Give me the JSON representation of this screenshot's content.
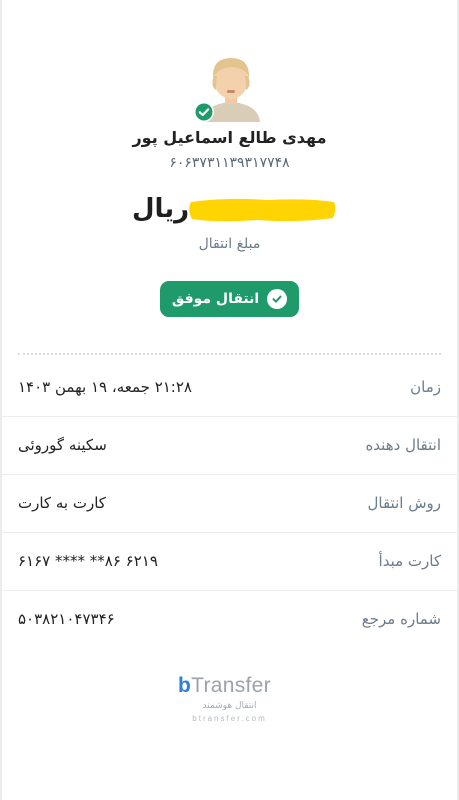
{
  "recipient": {
    "name": "مهدی طالع اسماعیل پور",
    "card_number": "۶۰۶۳۷۳۱۱۳۹۳۱۷۷۴۸"
  },
  "amount": {
    "currency": "ریال",
    "label": "مبلغ انتقال"
  },
  "status": {
    "label": "انتقال موفق",
    "color": "#1f9a6a"
  },
  "details": [
    {
      "label": "زمان",
      "value": "۲۱:۲۸ جمعه، ۱۹ بهمن ۱۴۰۳"
    },
    {
      "label": "انتقال دهنده",
      "value": "سکینه گوروئی"
    },
    {
      "label": "روش انتقال",
      "value": "کارت به کارت"
    },
    {
      "label": "کارت مبدأ",
      "value": "۶۱۶۷ **** **۸۶ ۶۲۱۹"
    },
    {
      "label": "شماره مرجع",
      "value": "۵۰۳۸۲۱۰۴۷۳۴۶"
    }
  ],
  "branding": {
    "logo_b": "b",
    "logo_rest": "Transfer",
    "tagline": "انتقال هوشمند",
    "url": "btransfer.com",
    "accent": "#2f7fd9"
  }
}
